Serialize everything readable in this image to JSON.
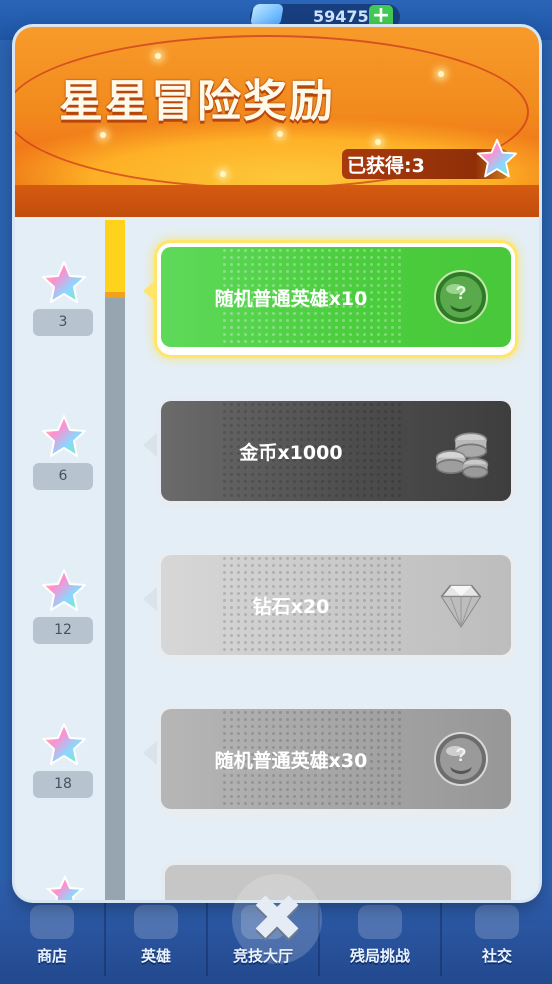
{
  "background": {
    "currency_amount": "59475",
    "currency_plus": "+",
    "nav": [
      {
        "label": "商店"
      },
      {
        "label": "英雄"
      },
      {
        "label": "竞技大厅"
      },
      {
        "label": "残局挑战"
      },
      {
        "label": "社交"
      }
    ]
  },
  "modal": {
    "title": "星星冒险奖励",
    "earned_label": "已获得:3",
    "close_glyph": "✖",
    "milestones": [
      {
        "count": "3"
      },
      {
        "count": "6"
      },
      {
        "count": "12"
      },
      {
        "count": "18"
      }
    ],
    "progress_fraction": 0.11,
    "rewards": [
      {
        "label": "随机普通英雄x10",
        "icon": "random-hero-icon",
        "state": "unlocked"
      },
      {
        "label": "金币x1000",
        "icon": "coins-icon",
        "state": "locked"
      },
      {
        "label": "钻石x20",
        "icon": "diamond-icon",
        "state": "locked"
      },
      {
        "label": "随机普通英雄x30",
        "icon": "random-hero-icon",
        "state": "locked"
      }
    ]
  },
  "colors": {
    "header_orange": "#f28a1d",
    "active_green": "#4bcd3e",
    "progress_yellow": "#ffd21c",
    "track_gray": "#97a5b1"
  }
}
